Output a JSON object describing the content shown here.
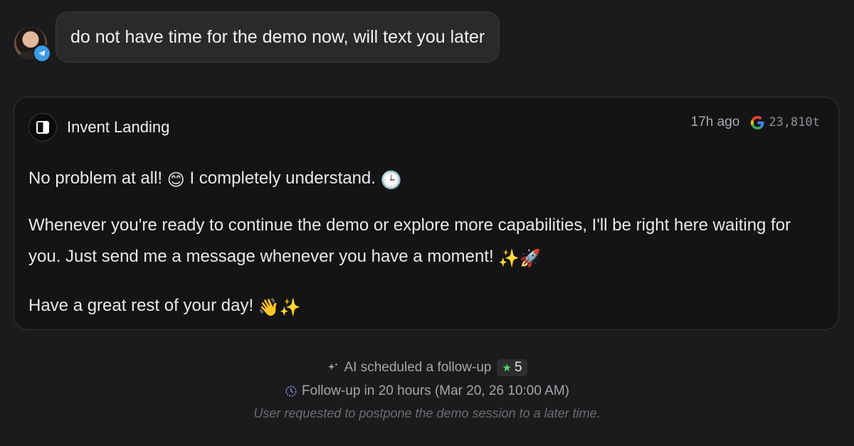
{
  "user_message": {
    "text": "do not have time for the demo now, will text you later",
    "channel_icon": "telegram-icon"
  },
  "bot_message": {
    "sender": "Invent Landing",
    "time_ago": "17h ago",
    "provider_icon": "google-icon",
    "tokens": "23,810t",
    "paragraphs": [
      {
        "text_a": "No problem at all! ",
        "emoji_a": "😊",
        "text_b": " I completely understand. ",
        "emoji_b": "🕒"
      },
      {
        "text": "Whenever you're ready to continue the demo or explore more capabilities, I'll be right here waiting for you. Just send me a message whenever you have a moment! ",
        "emoji": "✨🚀"
      },
      {
        "text": "Have a great rest of your day! ",
        "emoji": "👋✨"
      }
    ]
  },
  "followup": {
    "scheduled_label": "AI scheduled a follow-up",
    "score": "5",
    "schedule_text": "Follow-up in 20 hours (Mar 20, 26 10:00 AM)",
    "reason": "User requested to postpone the demo session to a later time.",
    "accent_color": "#4cd964"
  }
}
